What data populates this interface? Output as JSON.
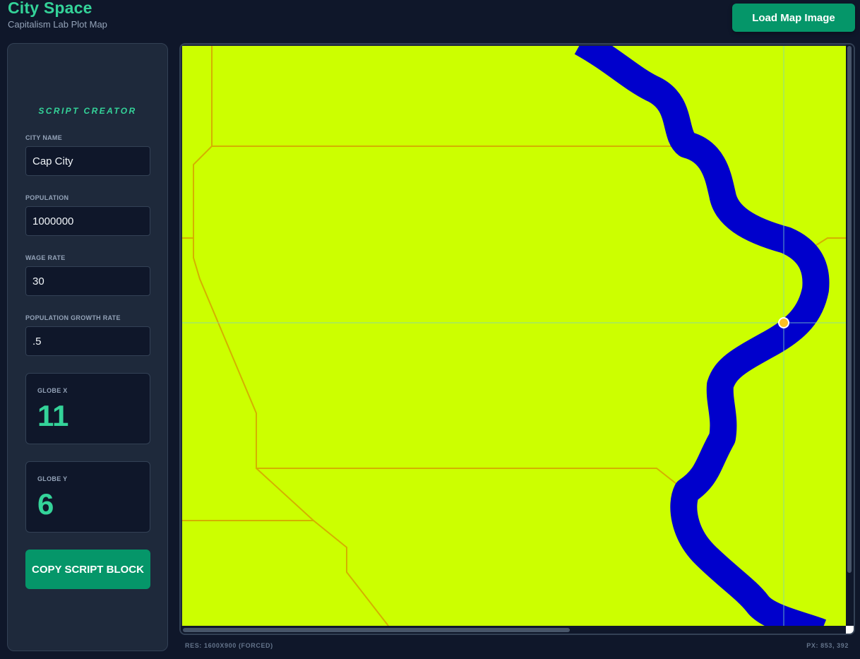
{
  "header": {
    "title": "City Space",
    "subtitle": "Capitalism Lab Plot Map",
    "load_button": "Load Map Image"
  },
  "sidebar": {
    "heading": "SCRIPT CREATOR",
    "fields": {
      "city_name": {
        "label": "CITY NAME",
        "value": "Cap City"
      },
      "population": {
        "label": "POPULATION",
        "value": "1000000"
      },
      "wage_rate": {
        "label": "WAGE RATE",
        "value": "30"
      },
      "growth_rate": {
        "label": "POPULATION GROWTH RATE",
        "value": ".5"
      }
    },
    "globe_x": {
      "label": "GLOBE X",
      "value": "11"
    },
    "globe_y": {
      "label": "GLOBE Y",
      "value": "6"
    },
    "copy_button": "COPY SCRIPT BLOCK"
  },
  "map": {
    "land_color": "#ccff00",
    "river_color": "#0000cc",
    "border_color": "#d4b000",
    "crosshair_color": "#7dd3c0",
    "marker_color": "#fbbf24"
  },
  "footer": {
    "resolution": "RES: 1600X900 (FORCED)",
    "pixel_readout": "PX: 853, 392"
  },
  "colors": {
    "accent": "#34d399",
    "button": "#059669",
    "panel": "#1e293b",
    "background": "#0f172a"
  }
}
